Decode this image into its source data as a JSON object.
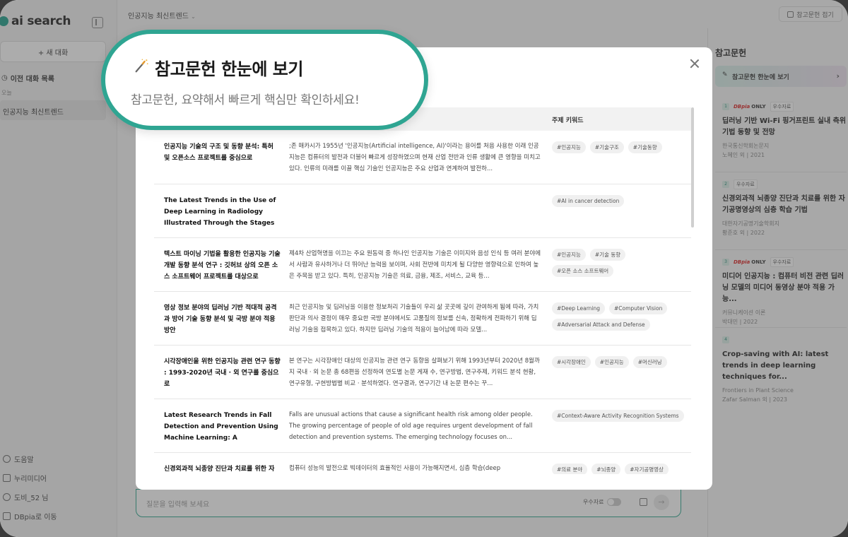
{
  "app": {
    "logo_text": "ai search",
    "breadcrumb": "인공지능 최신트렌드",
    "ref_collapse_label": "참고문헌 접기"
  },
  "sidebar": {
    "new_chat": "+ 새 대화",
    "history_title": "이전 대화 목록",
    "history_group": "오늘",
    "history_items": [
      "인공지능 최신트렌드"
    ],
    "bottom_links": [
      "도움말",
      "누리미디어",
      "도비_52 님",
      "DBpia로 이동"
    ]
  },
  "composer": {
    "placeholder": "질문을 입력해 보세요",
    "toggle_label": "우수자료"
  },
  "right_panel": {
    "title": "참고문헌",
    "banner": "참고문헌 한눈에 보기",
    "items": [
      {
        "num": "1",
        "dbpia": true,
        "excellent": true,
        "title": "딥러닝 기반 Wi-Fi 핑거프린트 실내 측위 기법 동향 및 전망",
        "source": "한국통신학회논문지",
        "meta": "노혜인 외 | 2021"
      },
      {
        "num": "2",
        "dbpia": false,
        "excellent": true,
        "title": "신경외과적 뇌종양 진단과 치료를 위한 자기공명영상의 심층 학습 기법",
        "source": "대한자기공명기술학회지",
        "meta": "황준호 외 | 2022"
      },
      {
        "num": "3",
        "dbpia": true,
        "excellent": true,
        "title": "미디어 인공지능 : 컴퓨터 비전 관련 딥러닝 모델의 미디어 동영상 분야 적용 가능...",
        "source": "커뮤니케이션 이론",
        "meta": "박대민 | 2022"
      },
      {
        "num": "4",
        "dbpia": false,
        "excellent": false,
        "title": "Crop-saving with AI: latest trends in deep learning techniques for...",
        "source": "Frontiers in Plant Science",
        "meta": "Zafar Salman 외 | 2023"
      }
    ],
    "dbpia_badge": "DBpia",
    "only_label": "ONLY",
    "excellent_badge": "우수자료"
  },
  "callout": {
    "title": "참고문헌 한눈에 보기",
    "subtitle": "참고문헌, 요약해서 빠르게 핵심만 확인하세요!"
  },
  "modal": {
    "column_keyword": "주제 키워드",
    "rows": [
      {
        "title": "인공지능 기술의 구조 및 동향 분석: 특허 및 오픈소스 프로젝트를 중심으로",
        "summary": ";존 매카시가 1955년 '인공지능(Artificial intelligence, AI)'이라는 용어를 처음 사용한 이래 인공지능은 컴퓨터의 발전과 더불어 빠르게 성장하였으며 현재 산업 전반과 인류 생활에 큰 영향을 미치고 있다. 인류의 미래를 이끌 핵심 기술인 인공지능은 주요 산업과 연계하여 발전하...",
        "keywords": [
          "#인공지능",
          "#기술구조",
          "#기술동향"
        ]
      },
      {
        "title": "The Latest Trends in the Use of Deep Learning in Radiology Illustrated Through the Stages of...",
        "summary": "",
        "keywords": [
          "#AI in cancer detection"
        ]
      },
      {
        "title": "텍스트 마이닝 기법을 활용한 인공지능 기술개발 동향 분석 연구 : 깃허브 상의 오픈 소스 소프트웨어 프로젝트를 대상으로",
        "summary": "제4차 산업혁명을 이끄는 주요 원동력 중 하나인 인공지능 기술은 이미지와 음성 인식 등 여러 분야에서 사람과 유사하거나 더 뛰어난 능력을 보이며, 사회 전반에 미치게 될 다양한 영향력으로 인하여 높은 주목을 받고 있다. 특히, 인공지능 기술은 의료, 금융, 제조, 서비스, 교육 등...",
        "keywords": [
          "#인공지능",
          "#기술 동향",
          "#오픈 소스 소프트웨어"
        ]
      },
      {
        "title": "영상 정보 분야의 딥러닝 기반 적대적 공격과 방어 기술 동향 분석 및 국방 분야 적용 방안",
        "summary": "최근 인공지능 및 딥러닝을 이용한 정보처리 기술들이 우리 삶 곳곳에 깊이 관여하게 됨에 따라, 가치판단과 의사 결정이 매우 중요한 국방 분야에서도 고품질의 정보를 신속, 정확하게 전파하기 위해 딥러닝 기술을 접목하고 있다. 하지만 딥러닝 기술의 적용이 늘어남에 따라 모델...",
        "keywords": [
          "#Deep Learning",
          "#Computer Vision",
          "#Adversarial Attack and Defense"
        ]
      },
      {
        "title": "시각장애인을 위한 인공지능 관련 연구 동향 : 1993-2020년 국내 · 외 연구를 중심으로",
        "summary": "본 연구는 시각장애인 대상의 인공지능 관련 연구 동향을 살펴보기 위해 1993년부터 2020년 8월까지 국내 · 외 논문 총 68편을 선정하여 연도별 논문 게재 수, 연구방법, 연구주제, 키워드 분석 현황, 연구유형, 구현방법별 비교 · 분석하였다. 연구결과, 연구기간 내 논문 편수는 꾸...",
        "keywords": [
          "#시각장애인",
          "#인공지능",
          "#머신러닝"
        ]
      },
      {
        "title": "Latest Research Trends in Fall Detection and Prevention Using Machine Learning: A Systematic...",
        "summary": "Falls are unusual actions that cause a significant health risk among older people. The growing percentage of people of old age requires urgent development of fall detection and prevention systems. The emerging technology focuses on...",
        "keywords": [
          "#Context-Aware Activity Recognition Systems"
        ]
      },
      {
        "title": "신경외과적 뇌종양 진단과 치료를 위한 자",
        "summary": "컴퓨터 성능의 발전으로 빅데이터의 효율적인 사용이 가능해지면서, 심층 학습(deep",
        "keywords": [
          "#의료 분야",
          "#뇌종양",
          "#자기공명영상"
        ]
      }
    ]
  }
}
